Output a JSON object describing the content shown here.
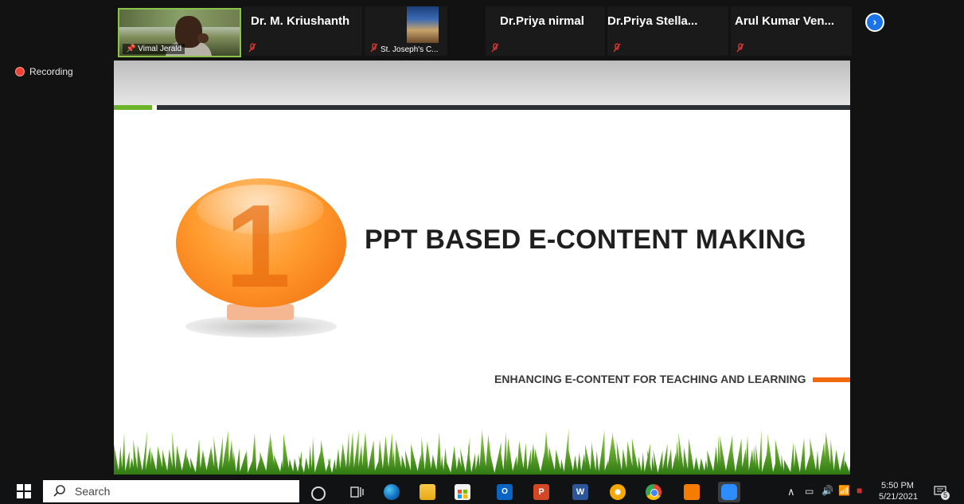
{
  "participants": [
    {
      "name": "Vimal Jerald"
    },
    {
      "name": "Dr. M. Kriushanth"
    },
    {
      "name": "St. Joseph's C..."
    },
    {
      "name": "Dr.Priya nirmal"
    },
    {
      "name": "Dr.Priya  Stella..."
    },
    {
      "name": "Arul  Kumar  Ven..."
    }
  ],
  "recording": {
    "label": "Recording"
  },
  "slide": {
    "number": "1",
    "title": "PPT BASED E-CONTENT MAKING",
    "subtitle": "ENHANCING E-CONTENT FOR TEACHING AND LEARNING"
  },
  "taskbar": {
    "search_placeholder": "Search",
    "time": "5:50 PM",
    "date": "5/21/2021",
    "notification_count": "5",
    "apps": [
      "cortana-icon",
      "task-view-icon",
      "edge-icon",
      "file-explorer-icon",
      "store-icon",
      "outlook-icon",
      "powerpoint-icon",
      "word-icon",
      "app-icon",
      "chrome-icon",
      "app-orange-icon",
      "zoom-icon"
    ]
  },
  "colors": {
    "accent_blue": "#1a73e8",
    "green": "#6cb52a",
    "orange": "#f26a10",
    "recording_red": "#ea4335"
  }
}
